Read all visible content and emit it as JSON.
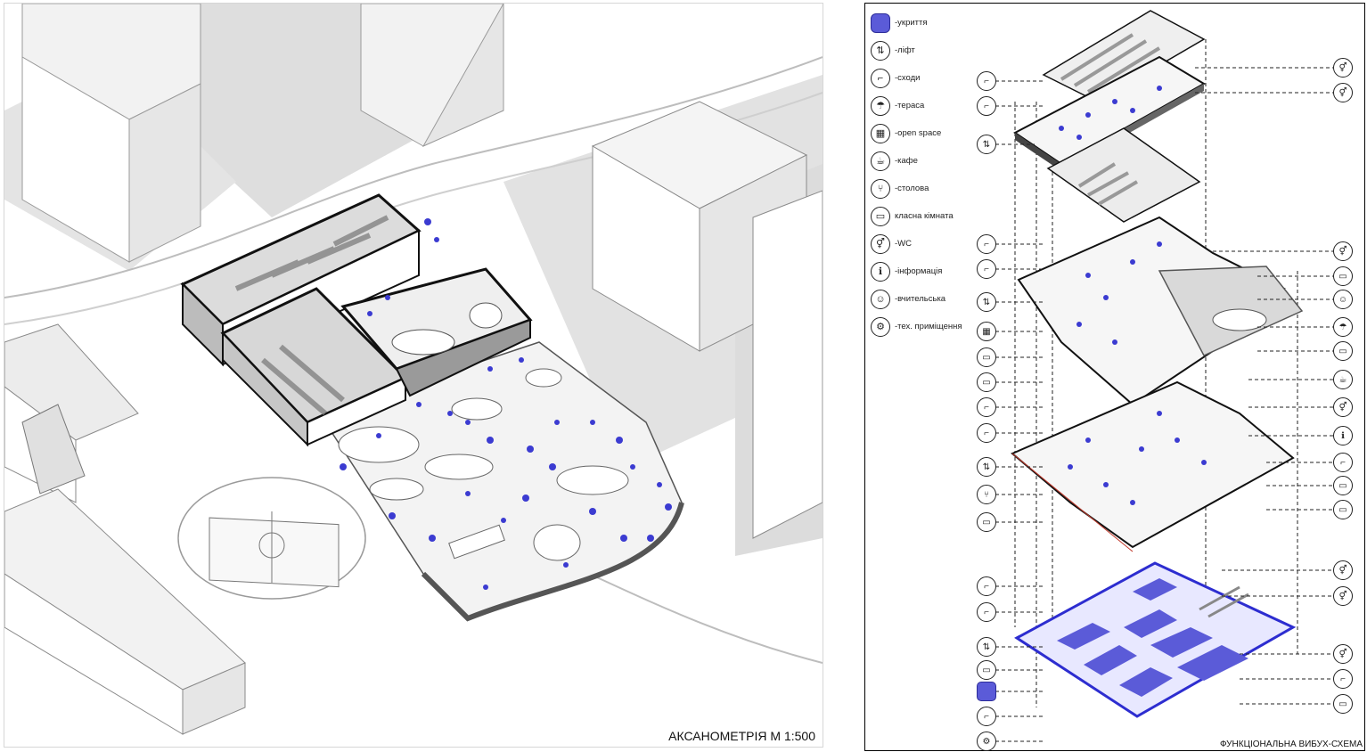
{
  "axonometry": {
    "caption": "АКСАНОМЕТРІЯ М 1:500"
  },
  "exploded": {
    "caption": "ФУНКЦІОНАЛЬНА ВИБУХ-СХЕМА",
    "legend": [
      {
        "icon": "shelter-icon",
        "label": "-укриття"
      },
      {
        "icon": "elevator-icon",
        "label": "-ліфт"
      },
      {
        "icon": "stairs-icon",
        "label": "-сходи"
      },
      {
        "icon": "terrace-icon",
        "label": "-тераса"
      },
      {
        "icon": "open-space-icon",
        "label": "-open space"
      },
      {
        "icon": "cafe-icon",
        "label": "-кафе"
      },
      {
        "icon": "dining-icon",
        "label": "-столова"
      },
      {
        "icon": "classroom-icon",
        "label": "класна кімната"
      },
      {
        "icon": "wc-icon",
        "label": "-WC"
      },
      {
        "icon": "information-icon",
        "label": "-інформація"
      },
      {
        "icon": "teachers-room-icon",
        "label": "-вчительська"
      },
      {
        "icon": "technical-room-icon",
        "label": "-тех. приміщення"
      }
    ],
    "colors": {
      "accent_blue": "#3b3bd1",
      "shelter_blue": "#5b5bd8",
      "line": "#111111",
      "ground_grey": "#d9d9d9"
    }
  }
}
